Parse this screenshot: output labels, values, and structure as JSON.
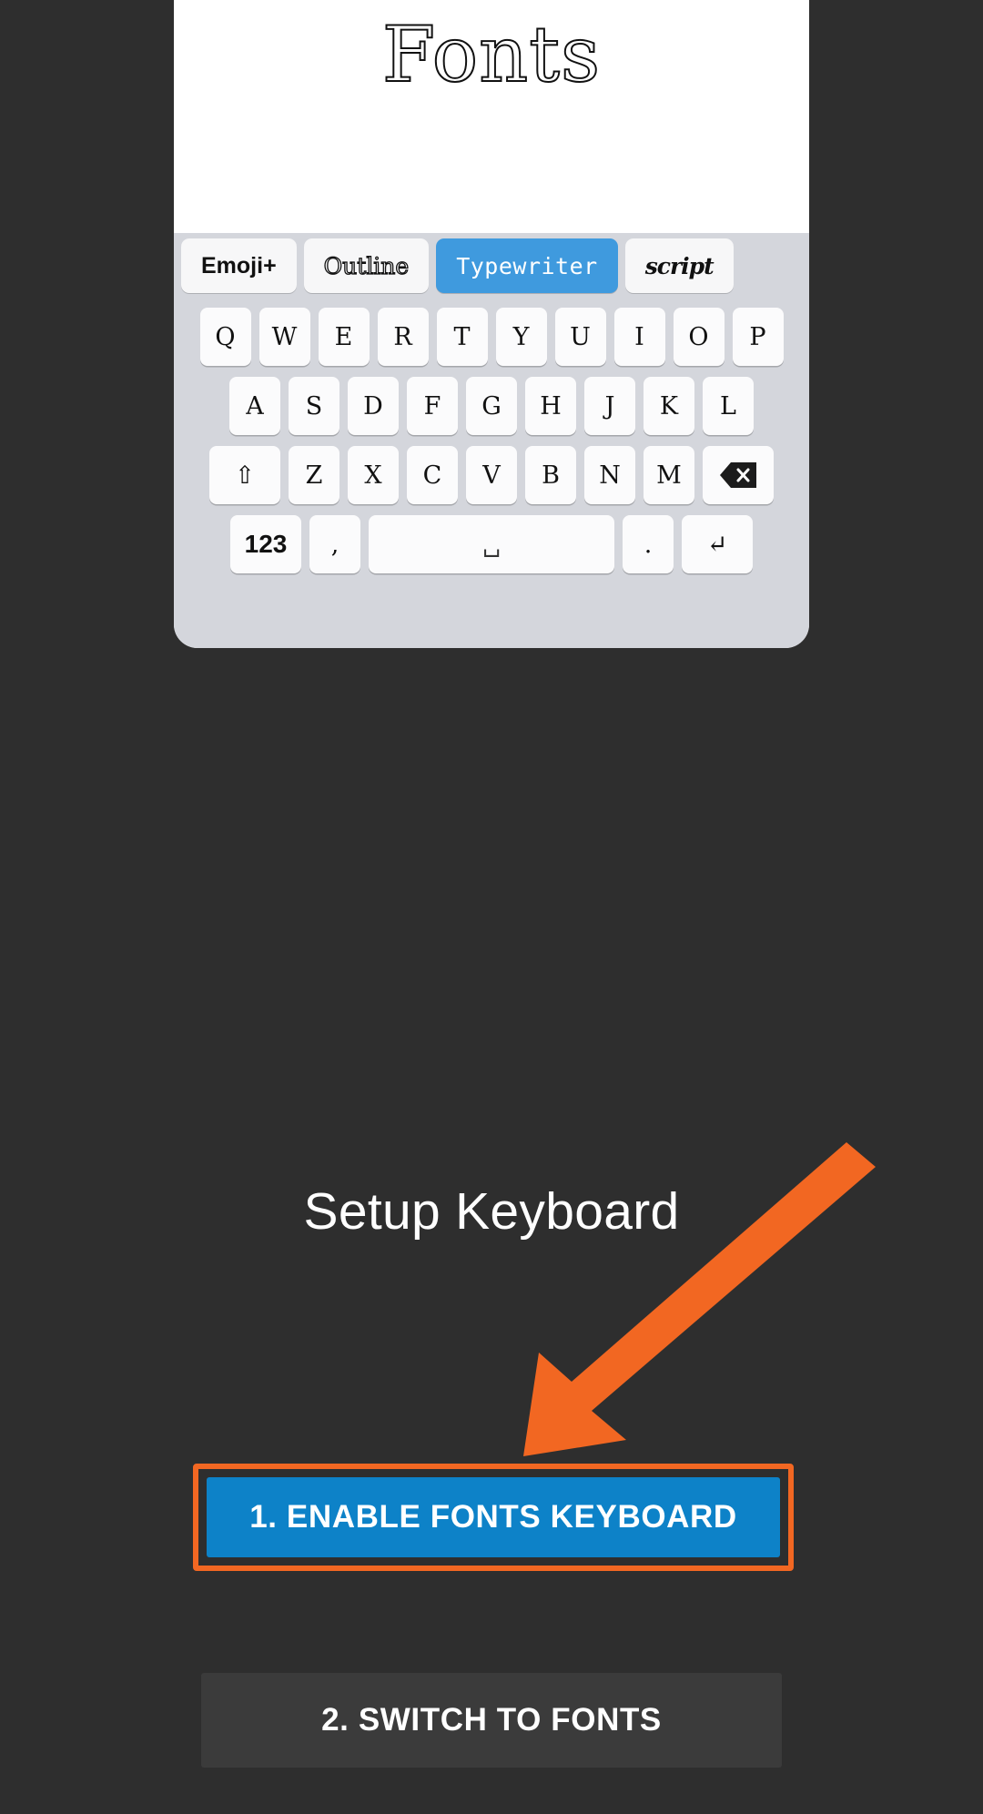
{
  "theme": {
    "background": "#2e2e2e",
    "accent_blue": "#0d82c8",
    "highlight_orange": "#f26722",
    "chip_selected_blue": "#3f9ade",
    "keyboard_bg": "#d4d6dc",
    "key_bg": "#fbfbfc",
    "secondary_button_bg": "#3b3b3b",
    "text_light": "#ffffff"
  },
  "preview": {
    "title": "Fonts",
    "font_tabs": [
      {
        "label": "Emoji+",
        "style": "emoji",
        "selected": false
      },
      {
        "label": "Outline",
        "style": "outline",
        "selected": false
      },
      {
        "label": "Typewriter",
        "style": "typewriter",
        "selected": true
      },
      {
        "label": "script",
        "style": "script",
        "selected": false
      }
    ],
    "keyboard": {
      "row1": [
        "Q",
        "W",
        "E",
        "R",
        "T",
        "Y",
        "U",
        "I",
        "O",
        "P"
      ],
      "row2": [
        "A",
        "S",
        "D",
        "F",
        "G",
        "H",
        "J",
        "K",
        "L"
      ],
      "row3": {
        "shift": "⇧",
        "letters": [
          "Z",
          "X",
          "C",
          "V",
          "B",
          "N",
          "M"
        ],
        "backspace": "backspace-icon"
      },
      "row4": {
        "numbers": "123",
        "comma": ",",
        "space": "␣",
        "period": ".",
        "return": "↵"
      }
    }
  },
  "setup": {
    "heading": "Setup Keyboard",
    "buttons": [
      {
        "label": "1. ENABLE FONTS KEYBOARD",
        "variant": "primary",
        "highlighted": true
      },
      {
        "label": "2. SWITCH TO FONTS",
        "variant": "secondary",
        "highlighted": false
      }
    ]
  },
  "annotation": {
    "arrow": {
      "icon": "arrow-down-left-icon",
      "color": "#f26722",
      "points_to": "1. ENABLE FONTS KEYBOARD"
    }
  }
}
